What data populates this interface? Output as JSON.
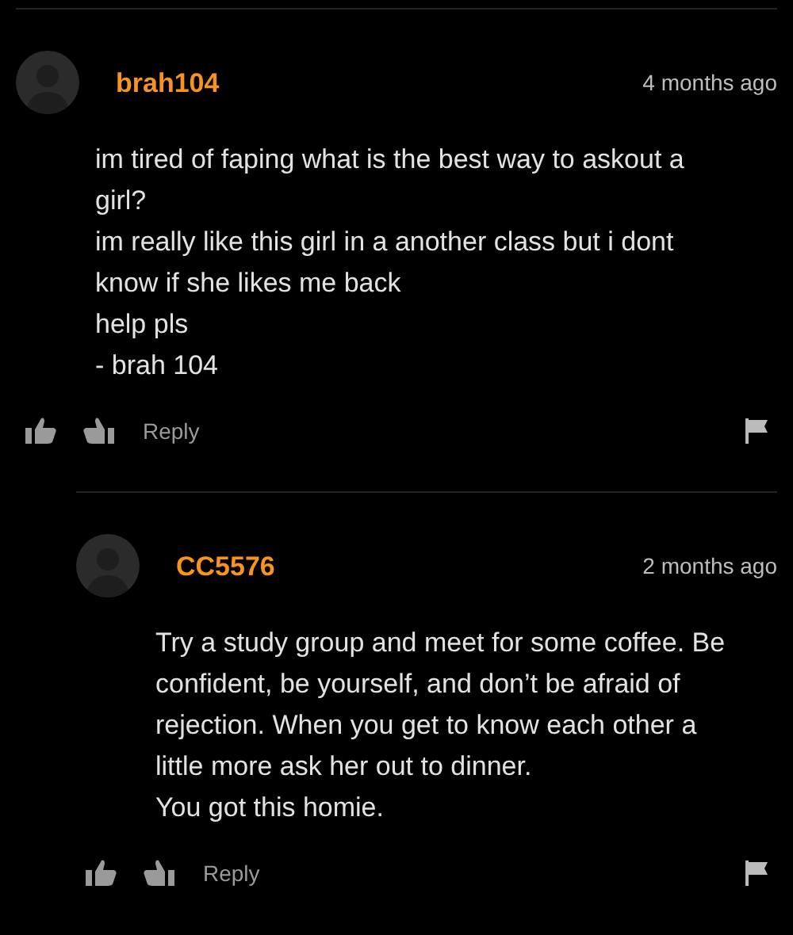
{
  "comments": [
    {
      "author": "brah104",
      "time": "4 months ago",
      "paragraphs": [
        "im tired of faping what is the best way to askout a girl?",
        "im really like this girl in a another class but i dont know if she likes me back",
        "help pls",
        "- brah 104"
      ],
      "reply_label": "Reply",
      "children": [
        {
          "author": "CC5576",
          "time": "2 months ago",
          "paragraphs": [
            "Try a study group and meet for some coffee. Be confident, be yourself, and don’t be afraid of rejection. When you get to know each other a little more ask her out to dinner.",
            "You got this homie."
          ],
          "reply_label": "Reply"
        }
      ]
    }
  ]
}
